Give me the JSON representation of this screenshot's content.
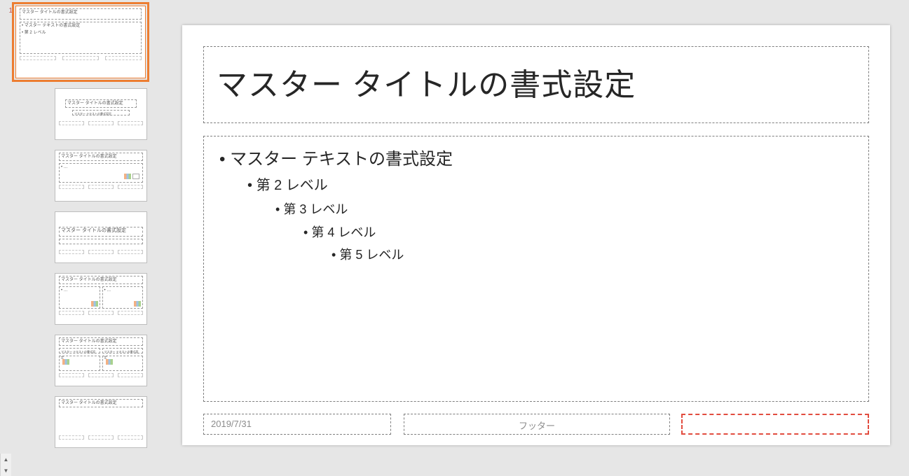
{
  "slideMaster": {
    "title": "マスター タイトルの書式設定",
    "bodyLevels": [
      "マスター テキストの書式設定",
      "第 2 レベル",
      "第 3 レベル",
      "第 4 レベル",
      "第 5 レベル"
    ],
    "date": "2019/7/31",
    "footer": "フッター",
    "slideNumber": ""
  },
  "thumbnails": {
    "masterIndex": "1",
    "masterTitle": "マスター タイトルの書式設定",
    "masterBodyLine1": "• マスター テキストの書式設定",
    "masterBodyLine2": "  • 第 2 レベル",
    "layouts": [
      {
        "title": "マスター タイトルの書式設定",
        "sub": "マスター テキストの書式設定"
      },
      {
        "title": "マスター タイトルの書式設定"
      },
      {
        "title": "マスター タイトルの書式設定"
      },
      {
        "title": "マスター タイトルの書式設定"
      },
      {
        "title": "マスター タイトルの書式設定",
        "leftCap": "マスター テキストの書式設定",
        "rightCap": "マスター テキストの書式設定"
      },
      {
        "title": "マスター タイトルの書式設定"
      }
    ]
  }
}
